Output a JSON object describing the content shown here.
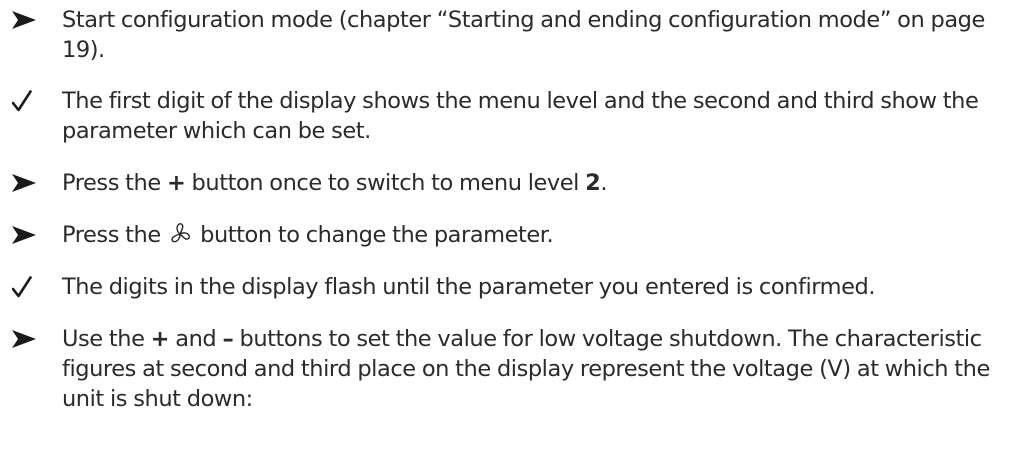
{
  "steps": [
    {
      "marker": "arrow-icon",
      "text": "Start configuration mode (chapter “Starting and ending configuration mode” on page 19)."
    },
    {
      "marker": "check-icon",
      "text": "The first digit of the display shows the menu level and the second and third show the parameter which can be set."
    },
    {
      "marker": "arrow-icon",
      "parts": {
        "a": "Press the ",
        "plus": "+",
        "b": " button once to switch to menu level ",
        "level": "2",
        "c": "."
      }
    },
    {
      "marker": "arrow-icon",
      "parts": {
        "a": "Press the ",
        "icon": "fan-icon",
        "b": " button to change the parameter."
      }
    },
    {
      "marker": "check-icon",
      "text": "The digits in the display flash until the parameter you entered is confirmed."
    },
    {
      "marker": "arrow-icon",
      "parts": {
        "a": "Use the ",
        "plus": "+",
        "b": " and ",
        "minus": "–",
        "c": " buttons to set the value for low voltage shutdown. The characteristic figures at second and third place on the display represent the voltage (V) at which the unit is shut down:"
      }
    }
  ],
  "colors": {
    "text": "#2b2b2b",
    "marker": "#1a1a1a"
  }
}
